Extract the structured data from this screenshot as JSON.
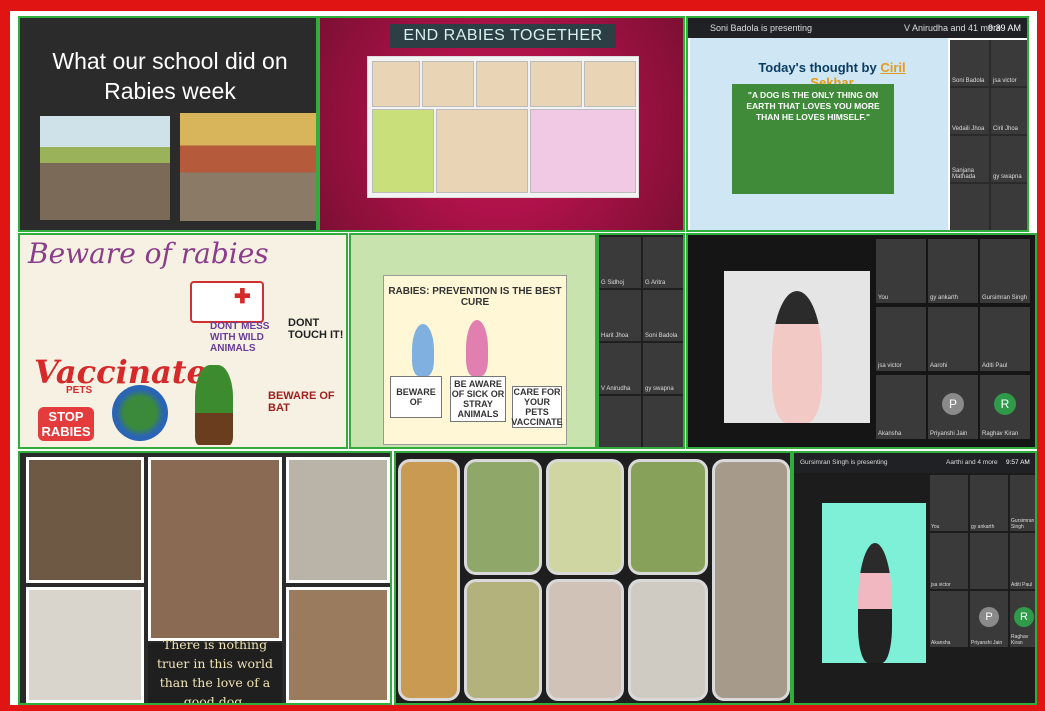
{
  "tile1": {
    "title_line1": "What our school did on",
    "title_line2": "Rabies week"
  },
  "tile2": {
    "banner": "END RABIES TOGETHER"
  },
  "tile3": {
    "presenting": "Soni Badola is presenting",
    "participants": "V Anirudha and 41 more",
    "time": "9:39 AM",
    "thought_prefix": "Today's thought by",
    "thought_author": "Ciril Sekhar",
    "quote": "\"A DOG IS THE ONLY THING ON EARTH THAT LOVES YOU MORE THAN HE LOVES HIMSELF.\"",
    "grid_names": [
      "Soni Badola",
      "jsa victor",
      "Vedaili Jhoa",
      "Ciril Jhoa",
      "Sanjana Mathada",
      "gy swapna",
      "",
      ""
    ]
  },
  "tile4": {
    "beware": "Beware of rabies",
    "vaccinate": "Vaccinate",
    "pets": "PETS",
    "stop": "STOP RABIES",
    "dont_mess": "DONT MESS WITH WILD ANIMALS",
    "dont_touch": "DONT TOUCH IT!",
    "beware_bat": "BEWARE OF BAT"
  },
  "tile5": {
    "poster_title": "RABIES: PREVENTION IS THE BEST CURE",
    "sign1": "BEWARE OF",
    "sign2": "BE AWARE OF SICK OR STRAY ANIMALS",
    "sign3": "CARE FOR YOUR PETS VACCINATE"
  },
  "tile6": {
    "names": [
      "G Sidhoj",
      "G Aritra",
      "Harit Jhoa",
      "Soni Badola",
      "V Anirudha",
      "gy swapna",
      "",
      ""
    ]
  },
  "tile7": {
    "names": [
      "You",
      "gy ankarth",
      "Gursimran Singh",
      "jsa victor",
      "Aarohi",
      "Aditi Paul",
      "Akansha",
      "Priyanshi Jain",
      "Raghav Kiran"
    ],
    "avatar_letters": [
      "P",
      "R"
    ],
    "avatar_colors": [
      "#8a8a8a",
      "#2e9a4a"
    ]
  },
  "tile8": {
    "caption": "There is nothing truer in this world than the love of a good dog."
  },
  "tile10": {
    "presenting": "Gursimran Singh is presenting",
    "participants": "Aarthi and 4 more",
    "time": "9:57 AM",
    "names": [
      "You",
      "gy ankarth",
      "Gursimran Singh",
      "jsa victor",
      "",
      "Aditi Paul",
      "Akansha",
      "Priyanshi Jain",
      "Raghav Kiran"
    ],
    "avatar_letters": [
      "P",
      "R"
    ]
  }
}
